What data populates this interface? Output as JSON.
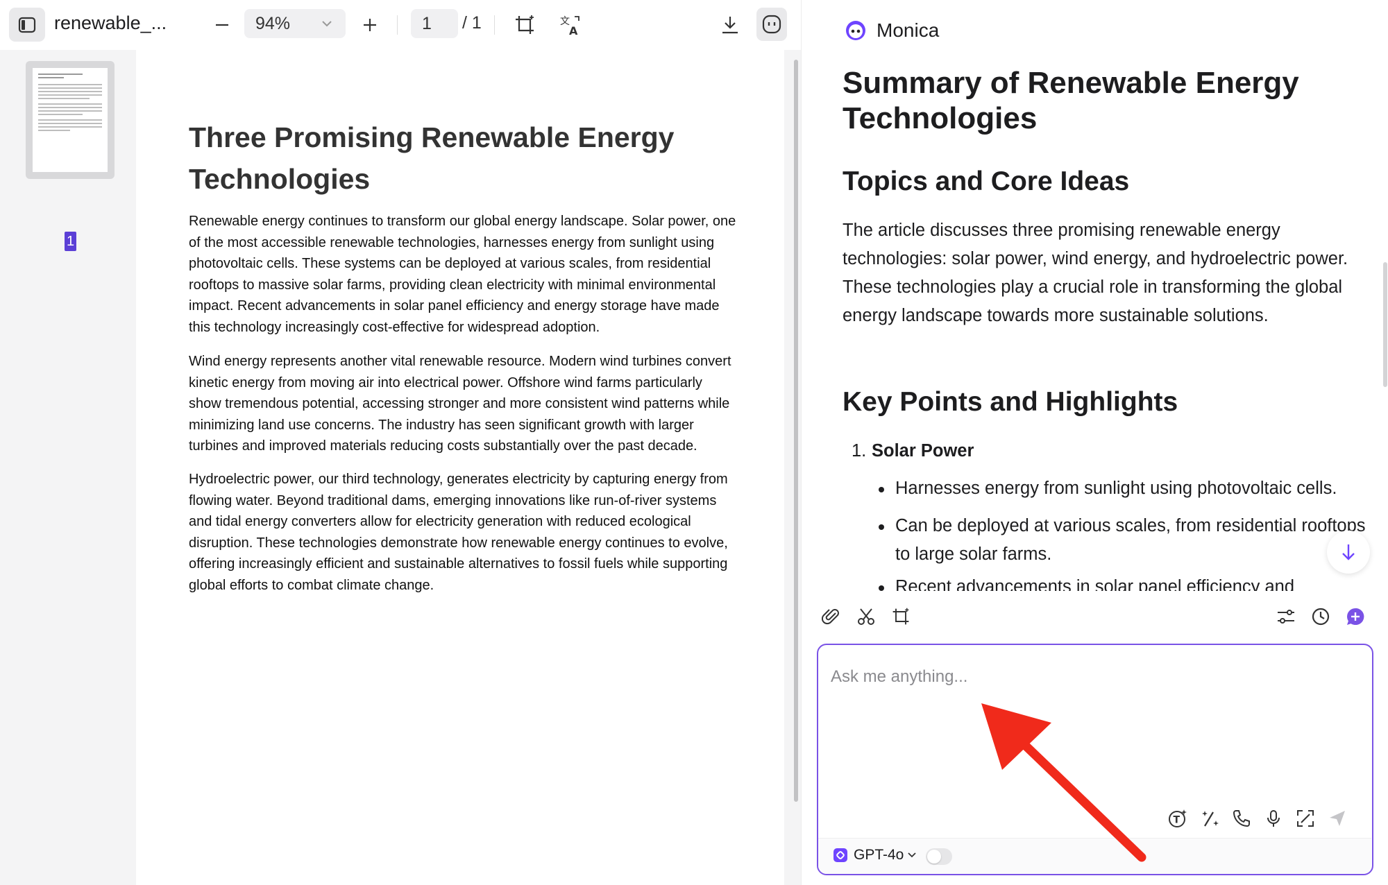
{
  "toolbar": {
    "file_name": "renewable_...",
    "zoom": "94%",
    "page_current": "1",
    "page_total": "/ 1"
  },
  "thumbnail": {
    "page_badge": "1"
  },
  "document": {
    "title": "Three Promising Renewable Energy Technologies",
    "paragraphs": [
      "Renewable energy continues to transform our global energy landscape. Solar power, one of the most accessible renewable technologies, harnesses energy from sunlight using photovoltaic cells. These systems can be deployed at various scales, from residential rooftops to massive solar farms, providing clean electricity with minimal environmental impact. Recent advancements in solar panel efficiency and energy storage have made this technology increasingly cost-effective for widespread adoption.",
      "Wind energy represents another vital renewable resource. Modern wind turbines convert kinetic energy from moving air into electrical power. Offshore wind farms particularly show tremendous potential, accessing stronger and more consistent wind patterns while minimizing land use concerns. The industry has seen significant growth with larger turbines and improved materials reducing costs substantially over the past decade.",
      "Hydroelectric power, our third technology, generates electricity by capturing energy from flowing water. Beyond traditional dams, emerging innovations like run-of-river systems and tidal energy converters allow for electricity generation with reduced ecological disruption. These technologies demonstrate how renewable energy continues to evolve, offering increasingly efficient and sustainable alternatives to fossil fuels while supporting global efforts to combat climate change."
    ]
  },
  "panel": {
    "brand_name": "Monica",
    "summary_title": "Summary of Renewable Energy Technologies",
    "section1_heading": "Topics and Core Ideas",
    "intro": "The article discusses three promising renewable energy technologies: solar power, wind energy, and hydroelectric power. These technologies play a crucial role in transforming the global energy landscape towards more sustainable solutions.",
    "section2_heading": "Key Points and Highlights",
    "key_points": {
      "number": "1.",
      "title": "Solar Power",
      "bullets": [
        "Harnesses energy from sunlight using photovoltaic cells.",
        "Can be deployed at various scales, from residential rooftops to large solar farms.",
        "Recent advancements in solar panel efficiency and"
      ]
    }
  },
  "input": {
    "placeholder": "Ask me anything...",
    "model": "GPT-4o"
  },
  "colors": {
    "accent": "#7a52e6",
    "annotation_arrow": "#f02a1b"
  }
}
